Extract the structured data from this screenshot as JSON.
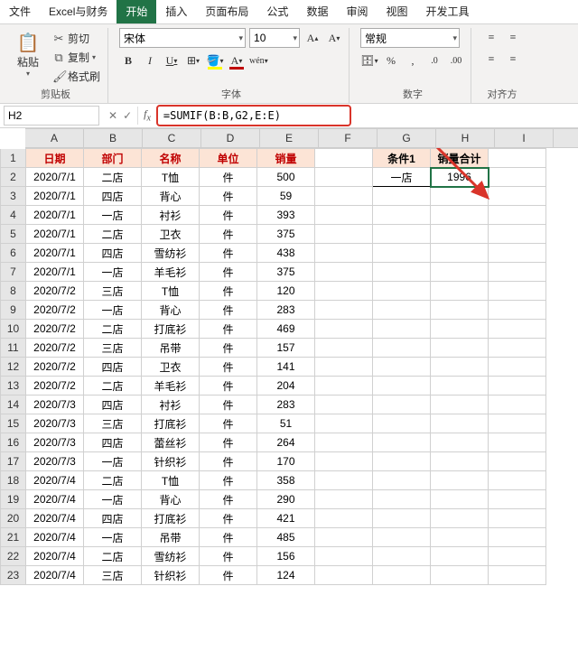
{
  "menu": {
    "items": [
      "文件",
      "Excel与财务",
      "开始",
      "插入",
      "页面布局",
      "公式",
      "数据",
      "审阅",
      "视图",
      "开发工具"
    ],
    "active": "开始"
  },
  "ribbon": {
    "clipboard": {
      "paste": "粘贴",
      "cut": "剪切",
      "copy": "复制",
      "fmt": "格式刷",
      "title": "剪贴板"
    },
    "font": {
      "name": "宋体",
      "size": "10",
      "title": "字体"
    },
    "number": {
      "fmt": "常规",
      "title": "数字"
    },
    "align": {
      "title": "对齐方"
    }
  },
  "namebox": "H2",
  "formula": "=SUMIF(B:B,G2,E:E)",
  "cols": [
    "A",
    "B",
    "C",
    "D",
    "E",
    "F",
    "G",
    "H",
    "I"
  ],
  "headers": {
    "A": "日期",
    "B": "部门",
    "C": "名称",
    "D": "单位",
    "E": "销量",
    "G": "条件1",
    "H": "销量合计"
  },
  "side": {
    "g2": "一店",
    "h2": "1996"
  },
  "rows": [
    {
      "n": 2,
      "d": "2020/7/1",
      "dep": "二店",
      "name": "T恤",
      "u": "件",
      "q": "500"
    },
    {
      "n": 3,
      "d": "2020/7/1",
      "dep": "四店",
      "name": "背心",
      "u": "件",
      "q": "59"
    },
    {
      "n": 4,
      "d": "2020/7/1",
      "dep": "一店",
      "name": "衬衫",
      "u": "件",
      "q": "393"
    },
    {
      "n": 5,
      "d": "2020/7/1",
      "dep": "二店",
      "name": "卫衣",
      "u": "件",
      "q": "375"
    },
    {
      "n": 6,
      "d": "2020/7/1",
      "dep": "四店",
      "name": "雪纺衫",
      "u": "件",
      "q": "438"
    },
    {
      "n": 7,
      "d": "2020/7/1",
      "dep": "一店",
      "name": "羊毛衫",
      "u": "件",
      "q": "375"
    },
    {
      "n": 8,
      "d": "2020/7/2",
      "dep": "三店",
      "name": "T恤",
      "u": "件",
      "q": "120"
    },
    {
      "n": 9,
      "d": "2020/7/2",
      "dep": "一店",
      "name": "背心",
      "u": "件",
      "q": "283"
    },
    {
      "n": 10,
      "d": "2020/7/2",
      "dep": "二店",
      "name": "打底衫",
      "u": "件",
      "q": "469"
    },
    {
      "n": 11,
      "d": "2020/7/2",
      "dep": "三店",
      "name": "吊带",
      "u": "件",
      "q": "157"
    },
    {
      "n": 12,
      "d": "2020/7/2",
      "dep": "四店",
      "name": "卫衣",
      "u": "件",
      "q": "141"
    },
    {
      "n": 13,
      "d": "2020/7/2",
      "dep": "二店",
      "name": "羊毛衫",
      "u": "件",
      "q": "204"
    },
    {
      "n": 14,
      "d": "2020/7/3",
      "dep": "四店",
      "name": "衬衫",
      "u": "件",
      "q": "283"
    },
    {
      "n": 15,
      "d": "2020/7/3",
      "dep": "三店",
      "name": "打底衫",
      "u": "件",
      "q": "51"
    },
    {
      "n": 16,
      "d": "2020/7/3",
      "dep": "四店",
      "name": "蕾丝衫",
      "u": "件",
      "q": "264"
    },
    {
      "n": 17,
      "d": "2020/7/3",
      "dep": "一店",
      "name": "针织衫",
      "u": "件",
      "q": "170"
    },
    {
      "n": 18,
      "d": "2020/7/4",
      "dep": "二店",
      "name": "T恤",
      "u": "件",
      "q": "358"
    },
    {
      "n": 19,
      "d": "2020/7/4",
      "dep": "一店",
      "name": "背心",
      "u": "件",
      "q": "290"
    },
    {
      "n": 20,
      "d": "2020/7/4",
      "dep": "四店",
      "name": "打底衫",
      "u": "件",
      "q": "421"
    },
    {
      "n": 21,
      "d": "2020/7/4",
      "dep": "一店",
      "name": "吊带",
      "u": "件",
      "q": "485"
    },
    {
      "n": 22,
      "d": "2020/7/4",
      "dep": "二店",
      "name": "雪纺衫",
      "u": "件",
      "q": "156"
    },
    {
      "n": 23,
      "d": "2020/7/4",
      "dep": "三店",
      "name": "针织衫",
      "u": "件",
      "q": "124"
    }
  ]
}
